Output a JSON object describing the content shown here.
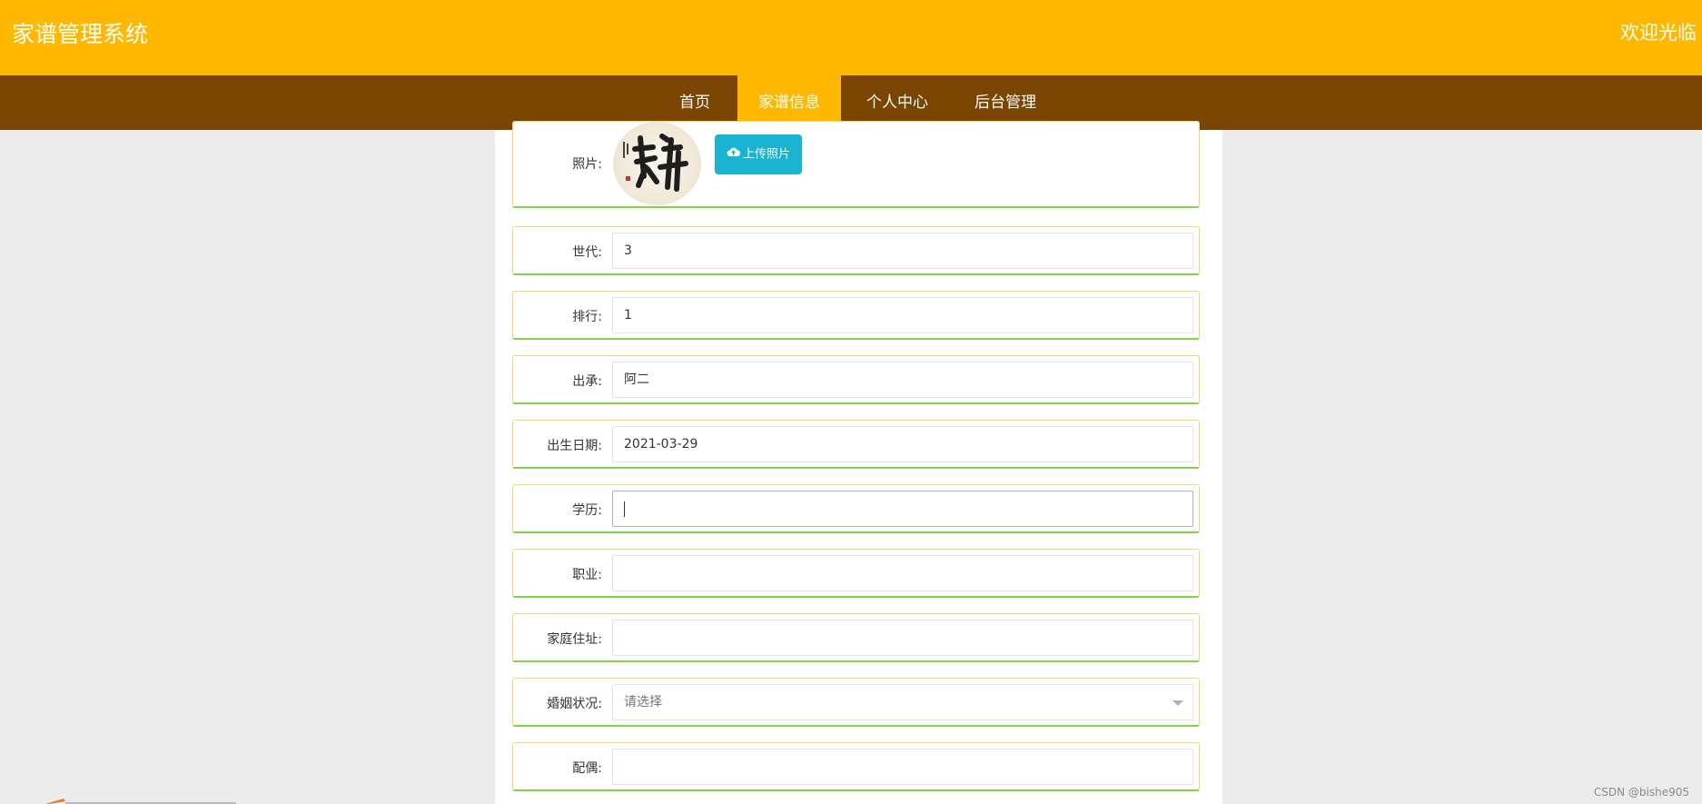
{
  "header": {
    "title": "家谱管理系统",
    "welcome": "欢迎光临"
  },
  "nav": {
    "items": [
      {
        "label": "首页"
      },
      {
        "label": "家谱信息"
      },
      {
        "label": "个人中心"
      },
      {
        "label": "后台管理"
      }
    ],
    "active_index": 1
  },
  "form": {
    "photo_label": "照片:",
    "upload_label": "上传照片",
    "generation": {
      "label": "世代:",
      "value": "3"
    },
    "rank": {
      "label": "排行:",
      "value": "1"
    },
    "lineage": {
      "label": "出承:",
      "value": "阿二"
    },
    "birthdate": {
      "label": "出生日期:",
      "value": "2021-03-29"
    },
    "education": {
      "label": "学历:",
      "value": ""
    },
    "occupation": {
      "label": "职业:",
      "value": ""
    },
    "address": {
      "label": "家庭住址:",
      "value": ""
    },
    "marital": {
      "label": "婚姻状况:",
      "placeholder": "请选择"
    },
    "spouse": {
      "label": "配偶:",
      "value": ""
    }
  },
  "watermark": "CSDN @bishe905",
  "colors": {
    "header_bg": "#ffb800",
    "nav_bg": "#7a4500",
    "nav_active": "#ffb800",
    "upload_button": "#1ab3d1",
    "row_border_top": "#ffd36b",
    "row_border_bottom": "#7ed64a"
  }
}
